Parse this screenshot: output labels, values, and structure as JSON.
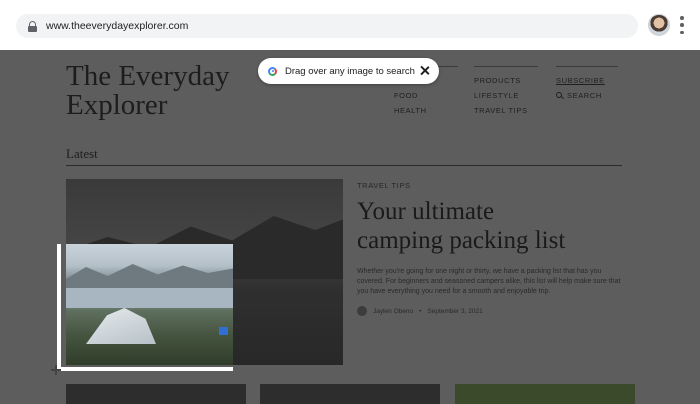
{
  "browser": {
    "url": "www.theeverydayexplorer.com",
    "icons": {
      "lock": "lock-icon",
      "avatar": "profile-avatar",
      "menu": "kebab-menu-icon"
    }
  },
  "lens_pill": {
    "text": "Drag over any image to search",
    "icons": {
      "lens": "google-lens-icon",
      "close": "close-icon"
    },
    "colors": {
      "blue": "#4285f4",
      "red": "#ea4335",
      "green": "#34a853"
    }
  },
  "site": {
    "title_line1": "The Everyday",
    "title_line2": "Explorer",
    "nav_col1": [
      "NS",
      "FOOD",
      "HEALTH"
    ],
    "nav_col2": [
      "PRODUCTS",
      "LIFESTYLE",
      "TRAVEL TIPS"
    ],
    "subscribe": "SUBSCRIBE",
    "search": "SEARCH"
  },
  "latest": {
    "heading": "Latest",
    "featured": {
      "kicker": "TRAVEL TIPS",
      "headline_line1": "Your ultimate",
      "headline_line2": "camping packing list",
      "excerpt": "Whether you're going for one night or thirty, we have a packing list that has you covered. For beginners and seasoned campers alike, this list will help make sure that you have everything you need for a smooth and enjoyable trip.",
      "author": "Jaylen Obeno",
      "date": "September 3, 2021"
    }
  }
}
